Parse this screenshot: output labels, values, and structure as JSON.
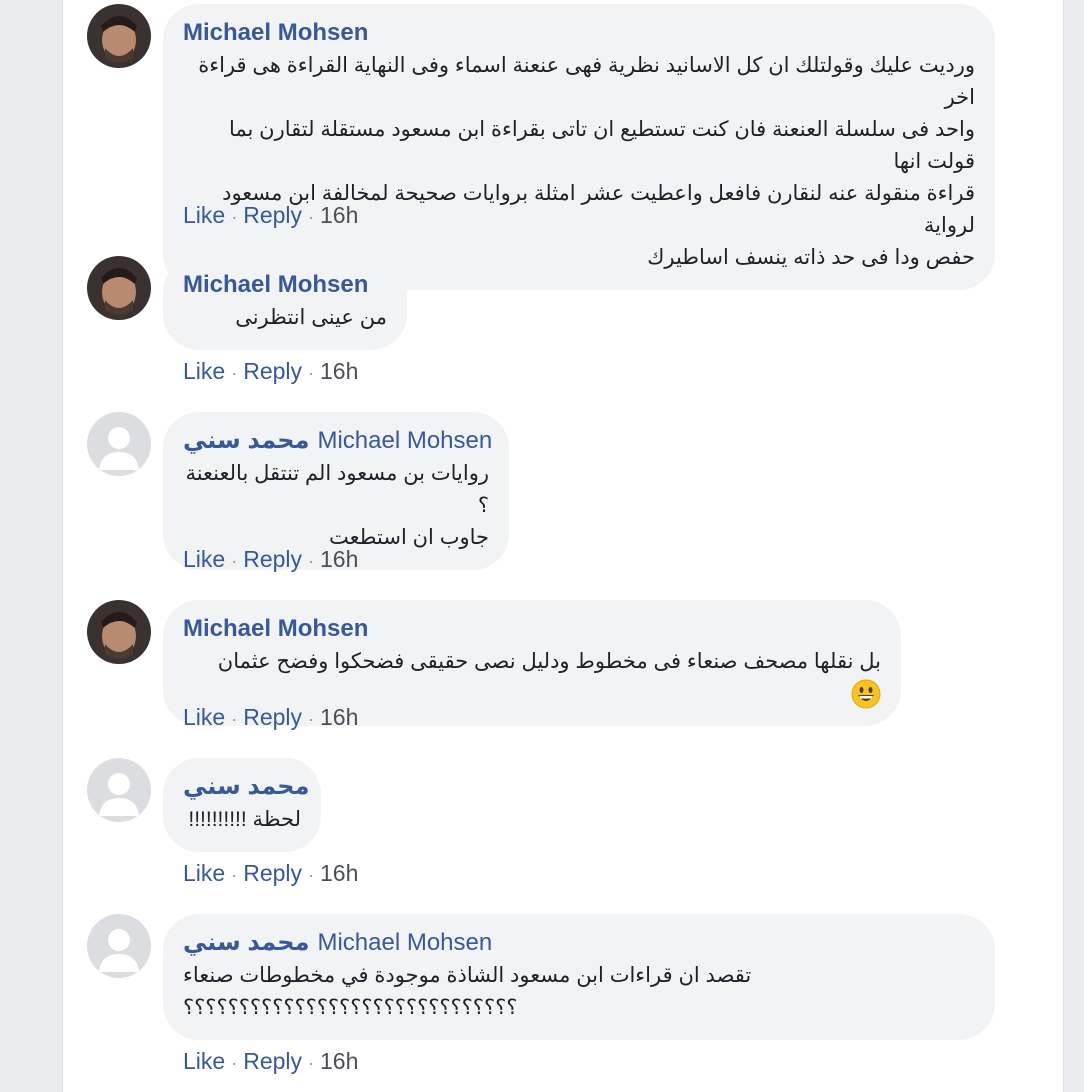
{
  "colors": {
    "link": "#385898",
    "bubble": "#f2f3f5",
    "text": "#1d2129"
  },
  "comments": [
    {
      "author": "Michael Mohsen",
      "tag": "",
      "avatar": "photo",
      "lines": [
        "ورديت عليك وقولتلك ان كل الاسانيد نظرية فهى عنعنة اسماء وفى النهاية القراءة هى قراءة اخر",
        "واحد فى سلسلة العنعنة فان كنت تستطيع ان تاتى بقراءة ابن مسعود مستقلة لتقارن بما قولت انها",
        "قراءة منقولة عنه لنقارن فافعل واعطيت عشر امثلة بروايات صحيحة لمخالفة ابن مسعود لرواية",
        "حفص ودا فى حد ذاته ينسف اساطيرك"
      ],
      "like": "Like",
      "reply": "Reply",
      "time": "16h"
    },
    {
      "author": "Michael Mohsen",
      "tag": "",
      "avatar": "photo",
      "lines": [
        "من عينى انتظرنى"
      ],
      "like": "Like",
      "reply": "Reply",
      "time": "16h"
    },
    {
      "author": "محمد سني",
      "tag": "Michael Mohsen",
      "avatar": "placeholder",
      "lines": [
        "روايات بن مسعود الم تنتقل بالعنعنة ؟",
        "جاوب ان استطعت"
      ],
      "like": "Like",
      "reply": "Reply",
      "time": "16h"
    },
    {
      "author": "Michael Mohsen",
      "tag": "",
      "avatar": "photo",
      "lines": [
        "بل نقلها مصحف صنعاء فى مخطوط ودليل نصى حقيقى فضحكوا وفضح عثمان"
      ],
      "emoji": "grinning-face",
      "like": "Like",
      "reply": "Reply",
      "time": "16h"
    },
    {
      "author": "محمد سني",
      "tag": "",
      "avatar": "placeholder",
      "lines": [
        "لحظة !!!!!!!!!!"
      ],
      "like": "Like",
      "reply": "Reply",
      "time": "16h"
    },
    {
      "author": "محمد سني",
      "tag": "Michael Mohsen",
      "avatar": "placeholder",
      "lines": [
        "تقصد ان قراءات ابن مسعود الشاذة موجودة في مخطوطات صنعاء",
        "؟؟؟؟؟؟؟؟؟؟؟؟؟؟؟؟؟؟؟؟؟؟؟؟؟؟؟؟؟؟"
      ],
      "like": "Like",
      "reply": "Reply",
      "time": "16h"
    }
  ]
}
